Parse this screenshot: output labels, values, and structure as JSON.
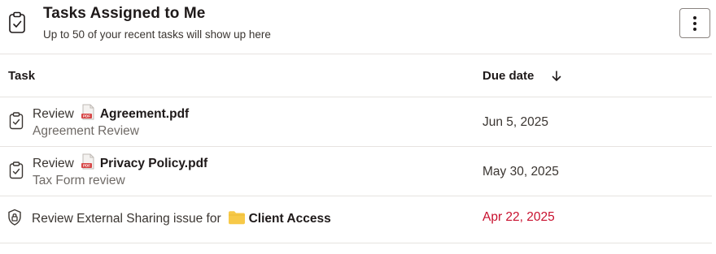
{
  "header": {
    "title": "Tasks Assigned to Me",
    "subtitle": "Up to 50 of your recent tasks will show up here",
    "icon": "clipboard-check-icon",
    "menu_icon": "more-vertical-icon"
  },
  "columns": {
    "task": "Task",
    "due_date": "Due date",
    "sort_icon": "arrow-down-icon"
  },
  "rows": [
    {
      "prefix": "Review",
      "item": "Agreement.pdf",
      "item_icon": "pdf-file-icon",
      "subtitle": "Agreement Review",
      "due": "Jun 5, 2025",
      "overdue": false,
      "icon": "clipboard-check-icon"
    },
    {
      "prefix": "Review",
      "item": "Privacy Policy.pdf",
      "item_icon": "pdf-file-icon",
      "subtitle": "Tax Form review",
      "due": "May 30, 2025",
      "overdue": false,
      "icon": "clipboard-check-icon"
    },
    {
      "prefix": "Review External Sharing issue for",
      "item": "Client Access",
      "item_icon": "folder-icon",
      "subtitle": "",
      "due": "Apr 22, 2025",
      "overdue": true,
      "icon": "shield-lock-icon"
    }
  ],
  "colors": {
    "overdue": "#c8102e",
    "folder": "#f7c948",
    "pdf": "#d64545"
  }
}
